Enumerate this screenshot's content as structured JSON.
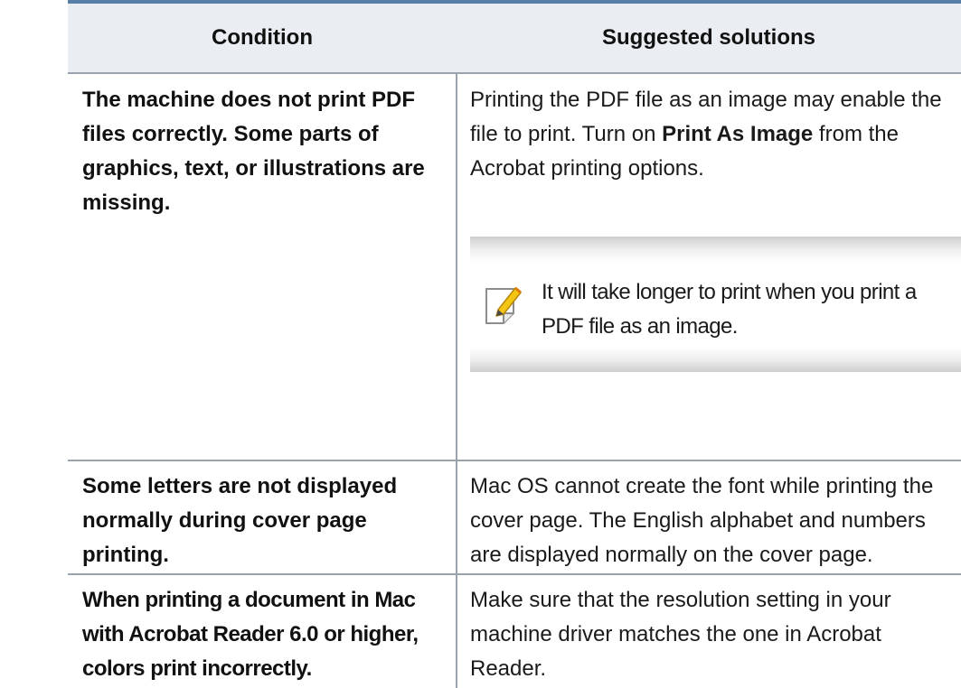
{
  "table": {
    "headers": {
      "condition": "Condition",
      "solutions": "Suggested solutions"
    },
    "rows": [
      {
        "condition": "The machine does not print PDF files correctly. Some parts of graphics, text, or illustrations are missing.",
        "solution_text_1": "Printing the PDF file as an image may enable the file to print. Turn on ",
        "solution_bold": "Print As Image",
        "solution_text_2": " from the Acrobat printing options.",
        "note": {
          "icon": "note-pencil-icon",
          "text": "It will take longer to print when you print a PDF file as an image."
        }
      },
      {
        "condition": "Some letters are not displayed normally during cover page printing.",
        "solution": "Mac OS cannot create the font while printing the cover page. The English alphabet and numbers are displayed normally on the cover page."
      },
      {
        "condition": "When printing a document in Mac with Acrobat Reader 6.0 or higher, colors print incorrectly.",
        "solution": "Make sure that the resolution setting in your machine driver matches the one in Acrobat Reader."
      }
    ]
  },
  "colors": {
    "header_background": "#eaeef3",
    "top_rule": "#5a7fa6",
    "grid_lines": "#9aa3ad",
    "note_icon_accent": "#f3c614"
  }
}
